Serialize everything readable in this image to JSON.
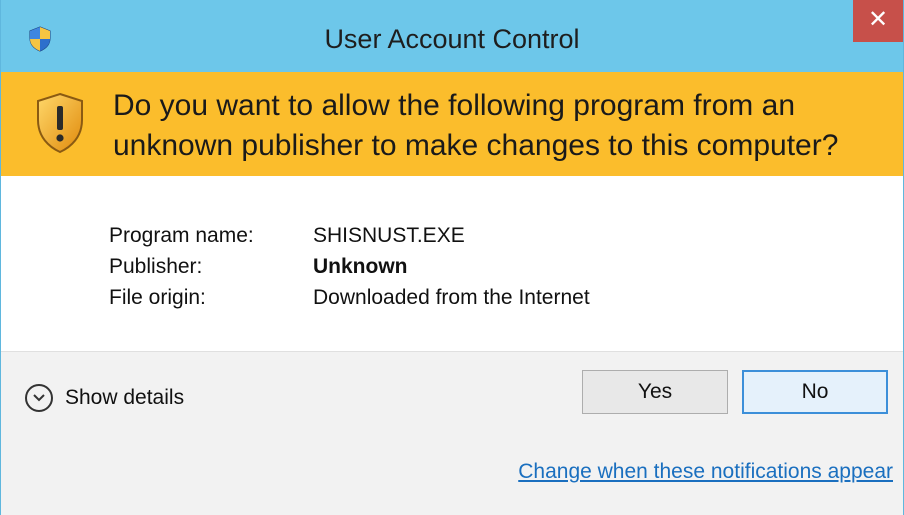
{
  "window": {
    "title": "User Account Control",
    "close_glyph": "✕"
  },
  "banner": {
    "question": "Do you want to allow the following program from an unknown publisher to make changes to this computer?"
  },
  "details": [
    {
      "label": "Program name:",
      "value": "SHISNUST.EXE"
    },
    {
      "label": "Publisher:",
      "value": "Unknown"
    },
    {
      "label": "File origin:",
      "value": "Downloaded from the Internet"
    }
  ],
  "footer": {
    "show_details": "Show details",
    "yes": "Yes",
    "no": "No",
    "change_link": "Change when these notifications appear"
  },
  "colors": {
    "titlebar": "#6dc7ea",
    "banner": "#fbbd2c",
    "close": "#c7504a",
    "link": "#1a6fbf"
  },
  "icons": {
    "title": "uac-shield-icon",
    "banner": "warning-shield-icon",
    "expand": "chevron-down-icon"
  }
}
